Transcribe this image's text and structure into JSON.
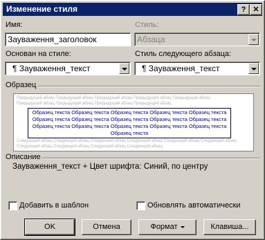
{
  "window": {
    "title": "Изменение стиля",
    "help_label": "?",
    "close_label": "✕"
  },
  "name_field": {
    "label": "Имя:",
    "value": "Зауваження_заголовок"
  },
  "style_type": {
    "label": "Стиль:",
    "value": "Абзаца"
  },
  "based_on": {
    "label": "Основан на стиле:",
    "value": "¶ Зауваження_текст"
  },
  "next_style": {
    "label": "Стиль следующего абзаца:",
    "value": "¶ Зауваження_текст"
  },
  "preview": {
    "label": "Образец",
    "gray_lines_top": [
      "Предыдущий абзац Предыдущий абзац Предыдущий абзац Предыдущий абзац Предыдущий абзац",
      "Предыдущий абзац Предыдущий абзац Предыдущий абзац Предыдущий абзац"
    ],
    "blue_lines": [
      "Образец текста Образец текста Образец текста Образец текста Образец текста",
      "Образец текста Образец текста Образец текста Образец текста Образец текста",
      "Образец текста Образец текста Образец текста Образец текста Образец текста",
      "Образец текста"
    ],
    "gray_lines_bottom": [
      "Следующий абзац Следующий абзац Следующий абзац Следующий абзац Следующий абзац Следующий абзац",
      "Следующий абзац Следующий абзац Следующий абзац Следующий абзац"
    ]
  },
  "description": {
    "label": "Описание",
    "text": "Зауваження_текст + Цвет шрифта: Синий, по центру"
  },
  "add_to_template": {
    "label": "Добавить в шаблон",
    "checked": false
  },
  "auto_update": {
    "label": "Обновлять автоматически",
    "checked": false
  },
  "buttons": {
    "ok": "OK",
    "cancel": "Отмена",
    "format": "Формат",
    "shortcut": "Клавиша..."
  }
}
